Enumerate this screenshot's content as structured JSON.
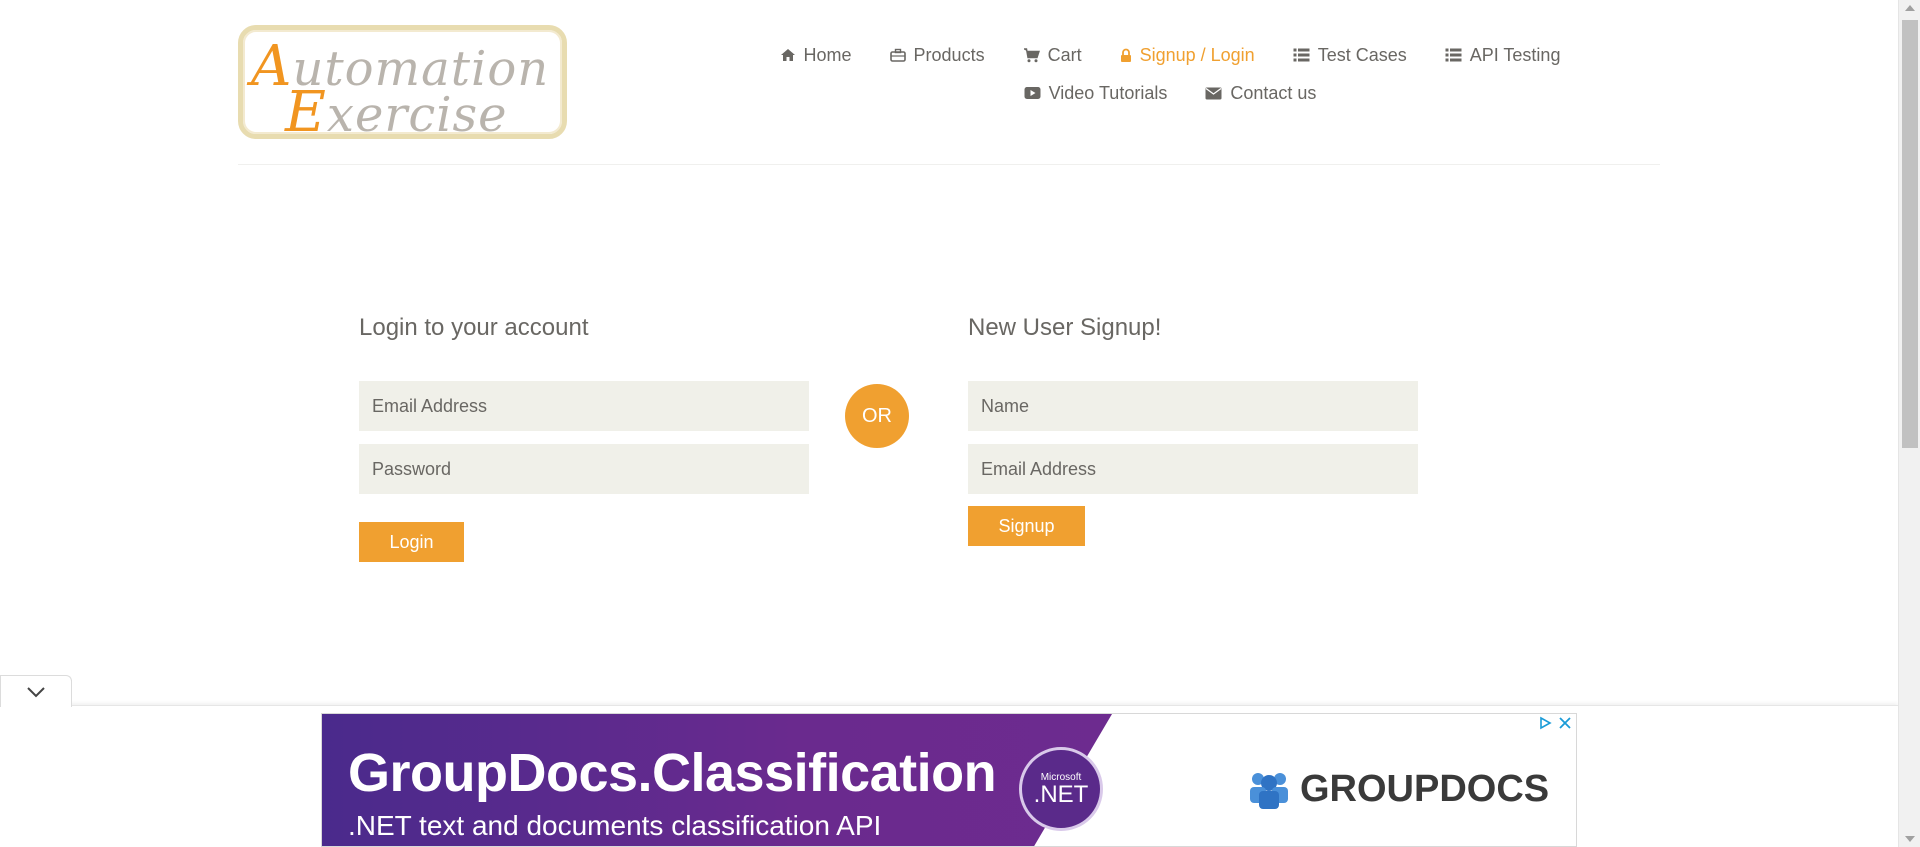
{
  "logo": {
    "line1_cap": "A",
    "line1_rest": "utomation",
    "line2_cap": "E",
    "line2_rest": "xercise"
  },
  "nav": {
    "row1": [
      {
        "label": "Home",
        "icon": "home-icon"
      },
      {
        "label": "Products",
        "icon": "briefcase-icon"
      },
      {
        "label": "Cart",
        "icon": "cart-icon"
      },
      {
        "label": "Signup / Login",
        "icon": "lock-icon",
        "active": true
      },
      {
        "label": "Test Cases",
        "icon": "list-icon"
      },
      {
        "label": "API Testing",
        "icon": "list-icon"
      }
    ],
    "row2": [
      {
        "label": "Video Tutorials",
        "icon": "youtube-icon"
      },
      {
        "label": "Contact us",
        "icon": "envelope-icon"
      }
    ]
  },
  "login": {
    "title": "Login to your account",
    "email_placeholder": "Email Address",
    "password_placeholder": "Password",
    "button": "Login"
  },
  "or_label": "OR",
  "signup": {
    "title": "New User Signup!",
    "name_placeholder": "Name",
    "email_placeholder": "Email Address",
    "button": "Signup"
  },
  "ad": {
    "title": "GroupDocs.Classification",
    "subtitle": ".NET text and documents classification API",
    "badge_small": "Microsoft",
    "badge_big": ".NET",
    "brand": "GROUPDOCS"
  },
  "colors": {
    "accent": "#f0a030",
    "text": "#696763",
    "input_bg": "#f0f0e9"
  }
}
